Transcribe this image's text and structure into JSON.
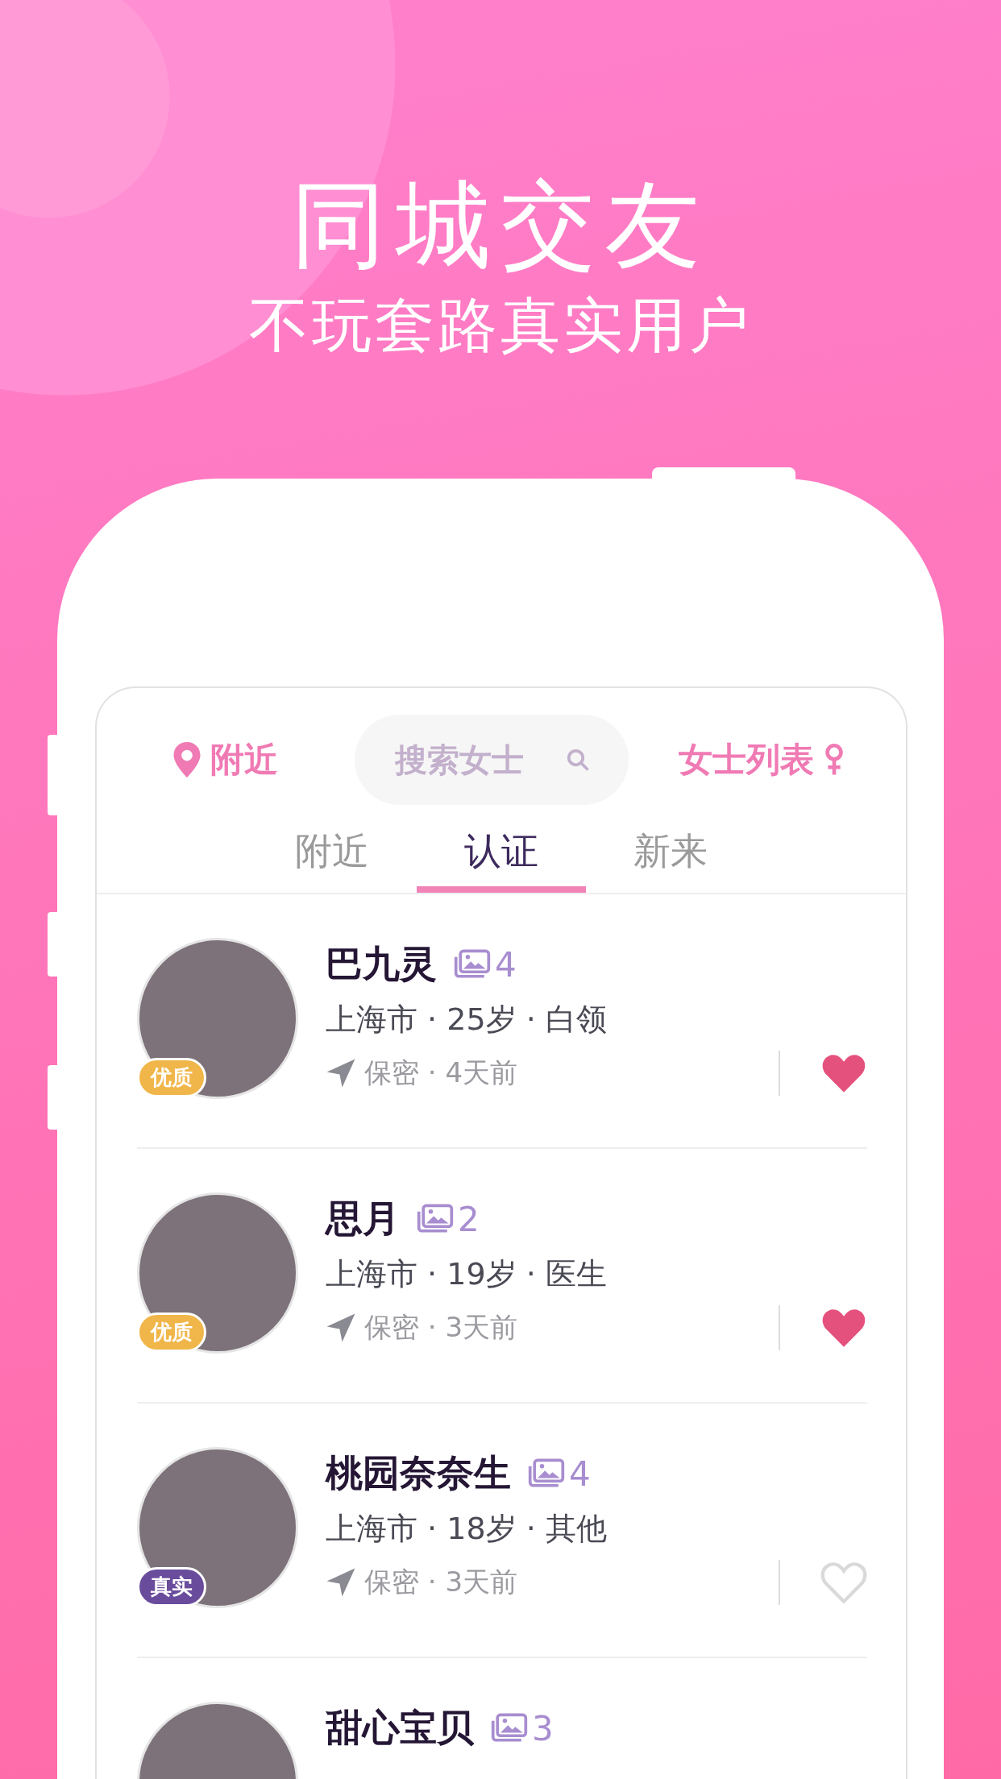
{
  "headline": "同城交友",
  "tagline": "不玩套路真实用户",
  "top_bar": {
    "nearby": "附近",
    "search": {
      "placeholder": "搜索女士"
    },
    "ladies_list": "女士列表"
  },
  "tabs": [
    {
      "label": "附近",
      "selected": false
    },
    {
      "label": "认证",
      "selected": true
    },
    {
      "label": "新来",
      "selected": false
    }
  ],
  "users": [
    {
      "name": "巴九灵",
      "photos": "4",
      "info": "上海市 · 25岁 · 白领",
      "meta": "保密 · 4天前",
      "badge": {
        "kind": "quality",
        "label": "优质"
      },
      "liked": true
    },
    {
      "name": "思月",
      "photos": "2",
      "info": "上海市 · 19岁 · 医生",
      "meta": "保密 · 3天前",
      "badge": {
        "kind": "quality",
        "label": "优质"
      },
      "liked": true
    },
    {
      "name": "桃园奈奈生",
      "photos": "4",
      "info": "上海市 · 18岁 · 其他",
      "meta": "保密 · 3天前",
      "badge": {
        "kind": "real",
        "label": "真实"
      },
      "liked": false
    },
    {
      "name": "甜心宝贝",
      "photos": "3"
    }
  ]
}
